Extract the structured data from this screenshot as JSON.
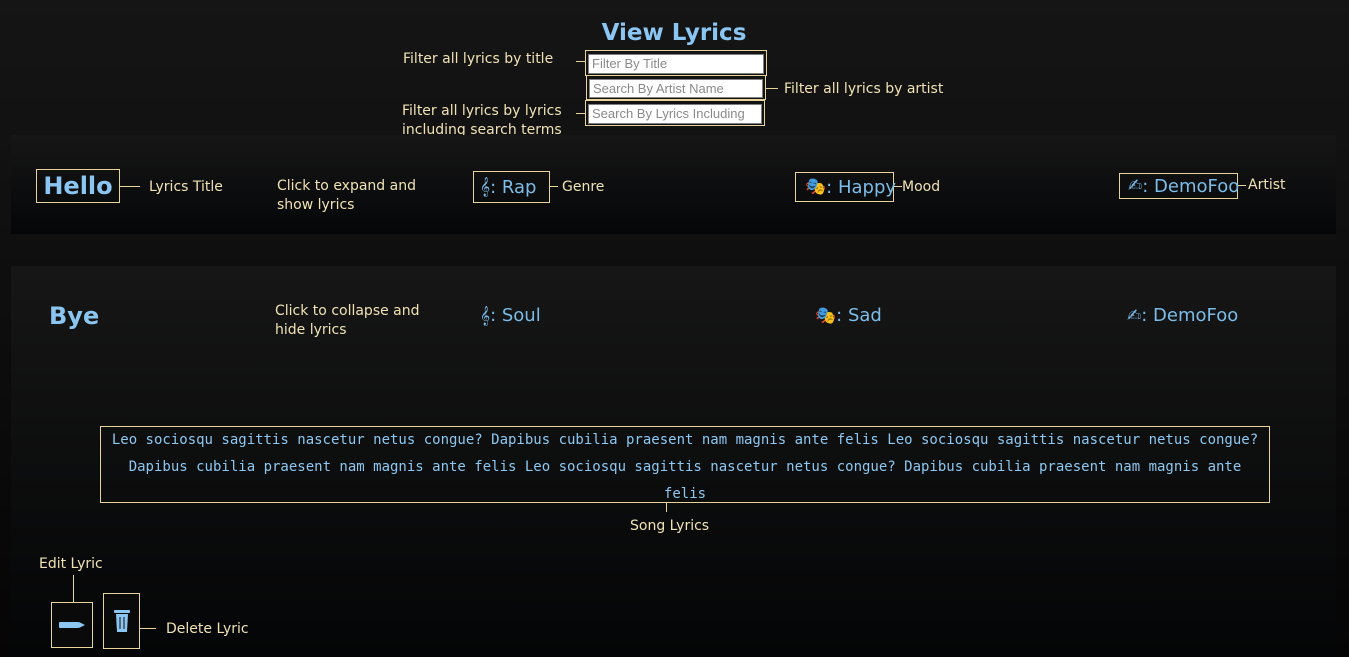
{
  "page": {
    "title": "View Lyrics"
  },
  "filters": {
    "title_placeholder": "Filter By Title",
    "artist_placeholder": "Search By Artist Name",
    "lyrics_placeholder": "Search By Lyrics Including",
    "title_annotation": "Filter all lyrics by title",
    "artist_annotation": "Filter all lyrics by artist",
    "lyrics_annotation": "Filter all lyrics by lyrics including search terms"
  },
  "lyrics_list": [
    {
      "title": "Hello",
      "genre_icon": "treble-clef-icon",
      "genre": ": Rap",
      "mood_icon": "theater-masks-icon",
      "mood": ": Happy",
      "artist_icon": "writing-hand-icon",
      "artist": ": DemoFoo",
      "expand_hint": "Click to expand and show lyrics",
      "annotations": {
        "title": "Lyrics Title",
        "genre": "Genre",
        "mood": "Mood",
        "artist": "Artist"
      }
    },
    {
      "title": "Bye",
      "genre_icon": "treble-clef-icon",
      "genre": ": Soul",
      "mood_icon": "theater-masks-icon",
      "mood": ": Sad",
      "artist_icon": "writing-hand-icon",
      "artist": ": DemoFoo",
      "collapse_hint": "Click to collapse and hide lyrics",
      "lyrics": "Leo sociosqu sagittis nascetur netus congue? Dapibus cubilia praesent nam magnis ante felis Leo sociosqu sagittis nascetur netus congue? Dapibus cubilia praesent nam magnis ante felis Leo sociosqu sagittis nascetur netus congue? Dapibus cubilia praesent nam magnis ante felis",
      "annotations": {
        "lyrics": "Song Lyrics",
        "edit": "Edit Lyric",
        "delete": "Delete Lyric"
      }
    }
  ],
  "icons": {
    "edit": "pencil-icon",
    "delete": "trash-can-icon"
  },
  "colors": {
    "accent": "#8bc6f3",
    "annotation": "#e8d49a",
    "background": "#0b0b0b"
  }
}
